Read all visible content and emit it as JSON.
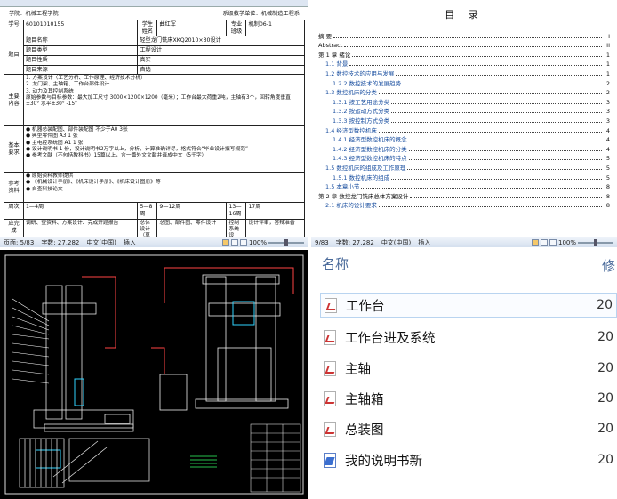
{
  "doc_form": {
    "header_left": "学院：机械工程学院",
    "header_right": "系级教学单位：机械制造工程系",
    "rows": {
      "student_no_label": "学号",
      "student_no": "60101010155",
      "name_label": "学生姓名",
      "name": "曲红军",
      "major_label": "专业班级",
      "major": "机制06-1",
      "topic_label": "题目",
      "topic_name_label": "题目名称",
      "topic_name": "轻型龙门铣床XKQ2010×30设计",
      "topic_type_label": "题目类型",
      "topic_type": "工程设计",
      "topic_nature_label": "题目性质",
      "topic_nature": "真实",
      "topic_source_label": "题目来源",
      "topic_source": "自选",
      "content_label": "主要内容",
      "content_lines": [
        "1. 方案设计（工艺分析、工作原理、经济技术分析）",
        "2. 龙门架、主轴箱、工作台部件设计",
        "3. 动力及其控制系统",
        "原始参数与目标参数：最大加工尺寸 3000×1200×1200（毫米）；工作台最大荷重2吨，主轴有3个，回转角度垂直±30° 水平±30° -15°"
      ],
      "req_label": "基本要求",
      "req_lines": [
        "● 机器总装配图、部件装配图 不少于A0 3张",
        "● 典型零件图 A3 1 张",
        "● 主电控系统图 A1 1 张",
        "● 设计说明书 1 份，设计说明书2万字以上，分析、计算准确详尽，格式符合“毕业设计撰写规范”",
        "● 参考文献（不包括教科书）15篇以上，含一篇外文文献并译成中文（5千字）"
      ],
      "ref_label": "参考资料",
      "ref_lines": [
        "● 原始资料教师提供",
        "● 《机械设计手册》、《机床设计手册》、《机床设计图册》等",
        "● 自查科技论文"
      ],
      "week_label": "周次",
      "weeks": [
        "1—4周",
        "5—8周",
        "9—12周",
        "13—16周",
        "17周"
      ],
      "stage_label": "应完成",
      "stages": [
        "调研、查资料、方案设计、完成开题报告",
        "总体设计（草图）、完成",
        "总图、部件图、零件设计",
        "控制系统设计，典型零件",
        "设计评审，答辩准备"
      ]
    },
    "status": {
      "page": "页面: 5/83",
      "words": "字数: 27,282",
      "lang": "中文(中国)",
      "mode": "插入",
      "zoom": "100%"
    }
  },
  "toc": {
    "title": "目 录",
    "items": [
      {
        "t": "摘 要",
        "p": "I",
        "lv": 1
      },
      {
        "t": "Abstract",
        "p": "II",
        "lv": 1
      },
      {
        "t": "第 1 章  绪论",
        "p": "1",
        "lv": 1
      },
      {
        "t": "1.1  背景",
        "p": "1",
        "lv": 2
      },
      {
        "t": "1.2  数控技术的应用与发展",
        "p": "1",
        "lv": 2
      },
      {
        "t": "1.2.2  数控技术的发展趋势",
        "p": "2",
        "lv": 3
      },
      {
        "t": "1.3  数控机床的分类",
        "p": "2",
        "lv": 2
      },
      {
        "t": "1.3.1  按工艺用途分类",
        "p": "3",
        "lv": 3
      },
      {
        "t": "1.3.2  按运动方式分类",
        "p": "3",
        "lv": 3
      },
      {
        "t": "1.3.3  按控制方式分类",
        "p": "3",
        "lv": 3
      },
      {
        "t": "1.4  经济型数控机床",
        "p": "4",
        "lv": 2
      },
      {
        "t": "1.4.1  经济型数控机床的概念",
        "p": "4",
        "lv": 3
      },
      {
        "t": "1.4.2  经济型数控机床的分类",
        "p": "4",
        "lv": 3
      },
      {
        "t": "1.4.3  经济型数控机床的特点",
        "p": "5",
        "lv": 3
      },
      {
        "t": "1.5  数控机床的组成及工作原理",
        "p": "5",
        "lv": 2
      },
      {
        "t": "1.5.1  数控机床的组成",
        "p": "5",
        "lv": 3
      },
      {
        "t": "1.5  本章小节",
        "p": "8",
        "lv": 2
      },
      {
        "t": "第 2 章  数控龙门铣床总体方案设计",
        "p": "8",
        "lv": 1
      },
      {
        "t": "2.1  机床的设计要求",
        "p": "8",
        "lv": 2
      }
    ],
    "status": {
      "page": "9/83",
      "words": "字数: 27,282",
      "lang": "中文(中国)",
      "mode": "插入",
      "zoom": "100%"
    }
  },
  "explorer": {
    "column_name": "名称",
    "column_modified": "修",
    "files": [
      {
        "name": "工作台",
        "date": "20"
      },
      {
        "name": "工作台进及系统",
        "date": "20"
      },
      {
        "name": "主轴",
        "date": "20"
      },
      {
        "name": "主轴箱",
        "date": "20"
      },
      {
        "name": "总装图",
        "date": "20"
      },
      {
        "name": "我的说明书新",
        "date": "20"
      }
    ]
  }
}
